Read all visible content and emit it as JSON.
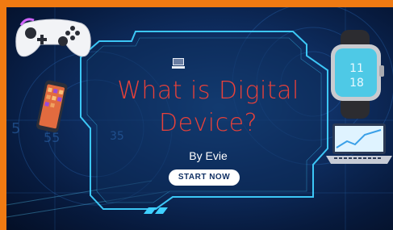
{
  "slide": {
    "title_line1": "What is Digital",
    "title_line2": "Device?",
    "byline": "By Evie",
    "start_button": "START NOW",
    "bg_numbers": [
      "5",
      "55",
      "35"
    ],
    "colors": {
      "frame": "#f07a12",
      "title": "#e8413a",
      "panel_border": "#3fd0ff",
      "background": "#0f2f63"
    },
    "icons": [
      "game-controller-icon",
      "smartphone-icon",
      "smartwatch-icon",
      "laptop-icon",
      "computer-icon"
    ]
  }
}
